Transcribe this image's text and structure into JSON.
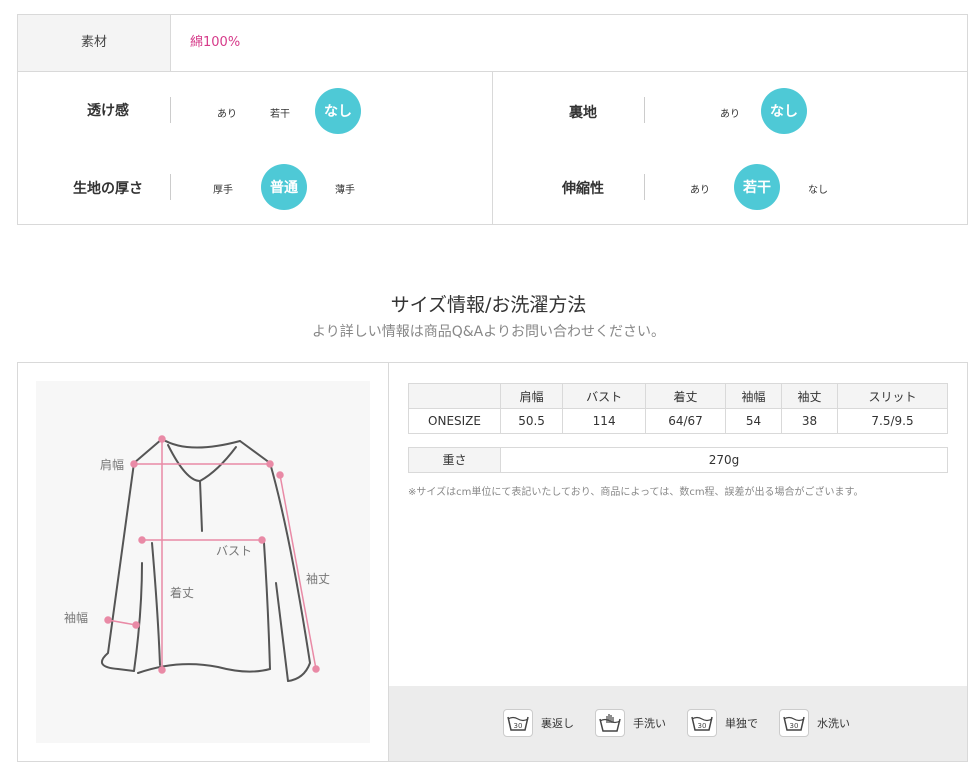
{
  "material": {
    "label": "素材",
    "value": "綿100%",
    "value_color": "#d63b8a"
  },
  "accent_color": "#4ec9d6",
  "properties_left": [
    {
      "name": "透け感",
      "options": [
        "あり",
        "若干",
        "なし"
      ],
      "selected": "なし"
    },
    {
      "name": "生地の厚さ",
      "options": [
        "厚手",
        "普通",
        "薄手"
      ],
      "selected": "普通"
    }
  ],
  "properties_right": [
    {
      "name": "裏地",
      "options": [
        "あり",
        "なし"
      ],
      "selected": "なし"
    },
    {
      "name": "伸縮性",
      "options": [
        "あり",
        "若干",
        "なし"
      ],
      "selected": "若干"
    }
  ],
  "size_section": {
    "title": "サイズ情報/お洗濯方法",
    "subtitle": "より詳しい情報は商品Q&Aよりお問い合わせください。"
  },
  "diagram_labels": {
    "shoulder": "肩幅",
    "bust": "バスト",
    "length": "着丈",
    "sleeve": "袖丈",
    "sleeve_width": "袖幅"
  },
  "size_table": {
    "headers": [
      "",
      "肩幅",
      "バスト",
      "着丈",
      "袖幅",
      "袖丈",
      "スリット"
    ],
    "rows": [
      [
        "ONESIZE",
        "50.5",
        "114",
        "64/67",
        "54",
        "38",
        "7.5/9.5"
      ]
    ]
  },
  "weight": {
    "label": "重さ",
    "value": "270g"
  },
  "note": "※サイズはcm単位にて表記いたしており、商品によっては、数cm程、誤差が出る場合がございます。",
  "wash": [
    {
      "icon": "wash-30-icon",
      "temp": "30",
      "label": "裏返し"
    },
    {
      "icon": "hand-wash-icon",
      "temp": "",
      "label": "手洗い"
    },
    {
      "icon": "wash-30-icon",
      "temp": "30",
      "label": "単独で"
    },
    {
      "icon": "wash-30-icon",
      "temp": "30",
      "label": "水洗い"
    }
  ]
}
